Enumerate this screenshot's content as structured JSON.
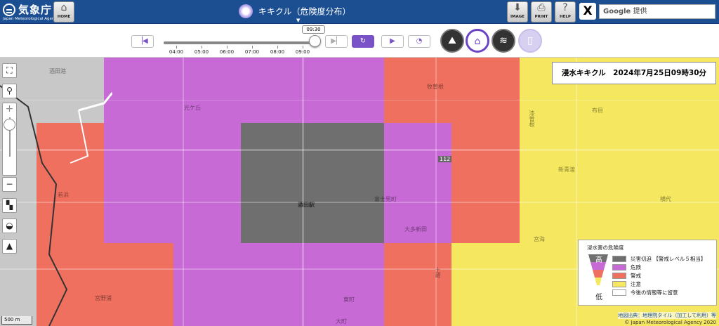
{
  "header": {
    "logo_jp": "気象庁",
    "logo_en": "Japan Meteorological Agency",
    "home_label": "HOME",
    "title": "キキクル（危険度分布）",
    "image_label": "IMAGE",
    "print_label": "PRINT",
    "help_label": "HELP",
    "x_label": "X",
    "search_brand": "Google",
    "search_placeholder": "提供"
  },
  "timeline": {
    "current_time": "09:30",
    "ticks": [
      "04:00",
      "05:00",
      "06:00",
      "07:00",
      "08:00",
      "09:00"
    ],
    "position_fraction": 1.0
  },
  "info_box": {
    "text": "浸水キキクル　2024年7月25日09時30分"
  },
  "legend": {
    "title": "浸水害の危険度",
    "high": "高",
    "low": "低",
    "items": [
      {
        "label": "災害切迫 【警戒レベル５相当】",
        "color": "#6f6f6f"
      },
      {
        "label": "危険",
        "color": "#c86ad6"
      },
      {
        "label": "警戒",
        "color": "#f07060"
      },
      {
        "label": "注意",
        "color": "#f5e860"
      },
      {
        "label": "今後の情報等に留意",
        "color": "#ffffff"
      }
    ]
  },
  "map": {
    "places": {
      "p1": "酒田港",
      "p2": "光ケ丘",
      "p3": "酒田駅",
      "p4": "富士見町",
      "p5": "大多新田",
      "p6": "牧曽根",
      "p7": "漆曽根",
      "p8": "布目",
      "p9": "新青渡",
      "p10": "横代",
      "p11": "宮野浦",
      "p12": "東町",
      "p13": "大町",
      "p14": "若浜",
      "p15": "宮海",
      "p16": "土崎"
    },
    "route_label": "112",
    "scale": "500 m"
  },
  "footer": {
    "credit": "地図出典：地理院タイル（加工して利用）等",
    "copyright": "© Japan Meteorological Agency 2020"
  },
  "colors": {
    "header_bg": "#1b4f92",
    "accent": "#7a52c7",
    "danger_dark": "#6f6f6f",
    "danger_purple": "#c86ad6",
    "warning_red": "#f07060",
    "caution_yellow": "#f5e860"
  }
}
